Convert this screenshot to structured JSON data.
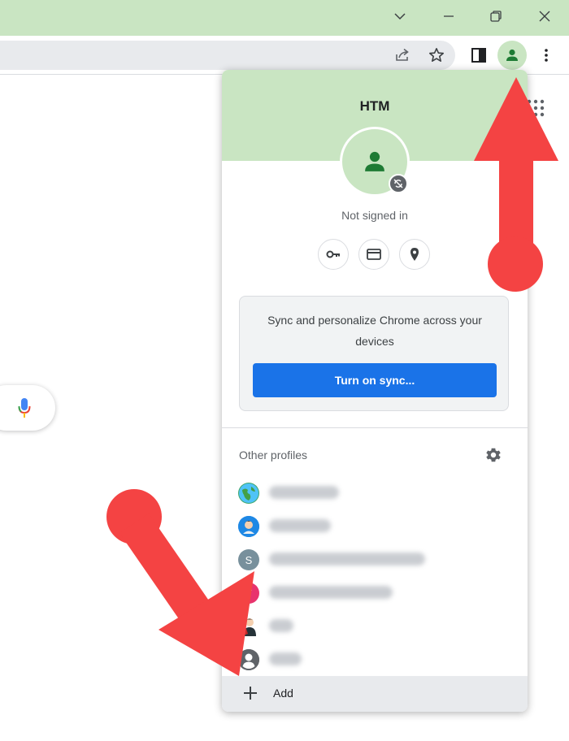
{
  "window": {
    "controls": [
      "tab-search",
      "minimize",
      "restore",
      "close"
    ]
  },
  "toolbar": {
    "icons": [
      "share-icon",
      "bookmark-star-icon",
      "side-panel-icon",
      "profile-icon",
      "menu-icon"
    ]
  },
  "profile_panel": {
    "name": "HTM",
    "status": "Not signed in",
    "quick_actions": [
      "key-icon",
      "card-icon",
      "location-icon"
    ],
    "sync": {
      "message": "Sync and personalize Chrome across your devices",
      "button_label": "Turn on sync..."
    },
    "other_profiles_label": "Other profiles",
    "other_profiles": [
      {
        "initial": "",
        "avatar_color": "#43a047",
        "kind": "globe"
      },
      {
        "initial": "",
        "avatar_color": "#1e88e5",
        "kind": "person-art"
      },
      {
        "initial": "S",
        "avatar_color": "#78909c",
        "kind": "letter"
      },
      {
        "initial": "T",
        "avatar_color": "#e8336d",
        "kind": "letter"
      },
      {
        "initial": "",
        "avatar_color": "#c62828",
        "kind": "person-art2"
      },
      {
        "initial": "",
        "avatar_color": "#5f6368",
        "kind": "generic"
      }
    ],
    "add_label": "Add"
  },
  "colors": {
    "accent_green": "#c9e5c2",
    "sync_blue": "#1a73e8",
    "arrow_red": "#f44343"
  }
}
